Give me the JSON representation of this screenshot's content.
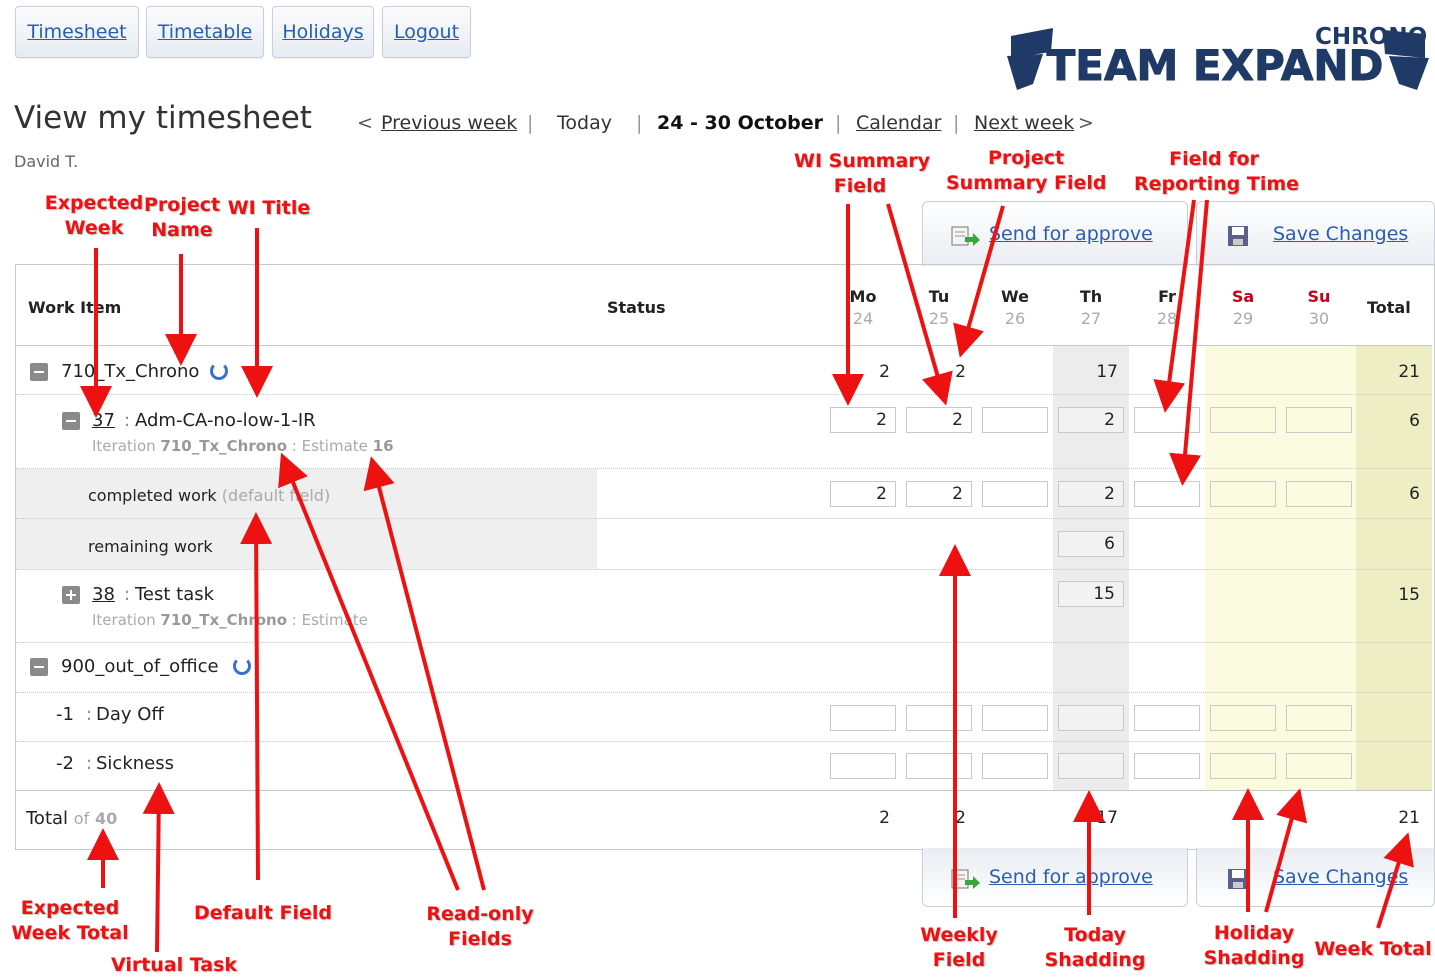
{
  "nav": [
    "Timesheet",
    "Timetable",
    "Holidays",
    "Logout"
  ],
  "logo": {
    "top": "CHRONO",
    "main": "TEAM EXPAND"
  },
  "page_title": "View my timesheet",
  "week_nav": {
    "prev": "Previous week",
    "today": "Today",
    "range": "24 - 30 October",
    "calendar": "Calendar",
    "next": "Next week",
    "lt": "<",
    "gt": ">",
    "bar": "|"
  },
  "user": "David T.",
  "actions": {
    "send": "Send for approve",
    "save": "Save Changes"
  },
  "columns": {
    "work_item": "Work Item",
    "status": "Status",
    "total": "Total"
  },
  "days": [
    {
      "name": "Mo",
      "num": "24"
    },
    {
      "name": "Tu",
      "num": "25"
    },
    {
      "name": "We",
      "num": "26"
    },
    {
      "name": "Th",
      "num": "27"
    },
    {
      "name": "Fr",
      "num": "28"
    },
    {
      "name": "Sa",
      "num": "29"
    },
    {
      "name": "Su",
      "num": "30"
    }
  ],
  "rows": {
    "p1": {
      "name": "710_Tx_Chrono",
      "mo": "2",
      "tu": "2",
      "th": "17",
      "total": "21"
    },
    "wi37": {
      "id": "37",
      "sep": ":",
      "title": "Adm-CA-no-low-1-IR",
      "iter_label": "Iteration",
      "iter": "710_Tx_Chrono",
      "est_label": ": Estimate",
      "est": "16",
      "mo": "2",
      "tu": "2",
      "th": "2",
      "total": "6"
    },
    "completed": {
      "label": "completed work",
      "note": "(default field)",
      "mo": "2",
      "tu": "2",
      "th": "2",
      "total": "6"
    },
    "remaining": {
      "label": "remaining work",
      "th": "6"
    },
    "wi38": {
      "id": "38",
      "sep": ":",
      "title": "Test task",
      "iter_label": "Iteration",
      "iter": "710_Tx_Chrono",
      "est_label": ": Estimate",
      "th": "15",
      "total": "15"
    },
    "p2": {
      "name": "900_out_of_office"
    },
    "dayoff": {
      "id": "-1",
      "sep": ":",
      "title": "Day Off"
    },
    "sick": {
      "id": "-2",
      "sep": ":",
      "title": "Sickness"
    }
  },
  "totals": {
    "label": "Total",
    "of": "of",
    "expected": "40",
    "mo": "2",
    "tu": "2",
    "th": "17",
    "week": "21"
  },
  "annotations": {
    "expected_week": [
      "Expected",
      "Week"
    ],
    "project_name": [
      "Project",
      "Name"
    ],
    "wi_title": [
      "WI Title"
    ],
    "wi_summary": [
      "WI Summary",
      "Field"
    ],
    "project_summary": [
      "Project",
      "Summary Field"
    ],
    "reporting_time": [
      "Field for",
      "Reporting Time"
    ],
    "expected_week_total": [
      "Expected",
      "Week Total"
    ],
    "virtual_task": [
      "Virtual Task"
    ],
    "default_field": [
      "Default Field"
    ],
    "readonly": [
      "Read-only",
      "Fields"
    ],
    "weekly_field": [
      "Weekly",
      "Field"
    ],
    "today_shading": [
      "Today",
      "Shadding"
    ],
    "holiday_shading": [
      "Holiday",
      "Shadding"
    ],
    "week_total": [
      "Week Total"
    ]
  },
  "colors": {
    "annotation": "#ee1111",
    "link": "#2a5db0",
    "weekend": "#c8001e",
    "today_shade": "#ececec",
    "holiday_shade": "#fbfbe0",
    "total_shade": "#eeeec4"
  }
}
